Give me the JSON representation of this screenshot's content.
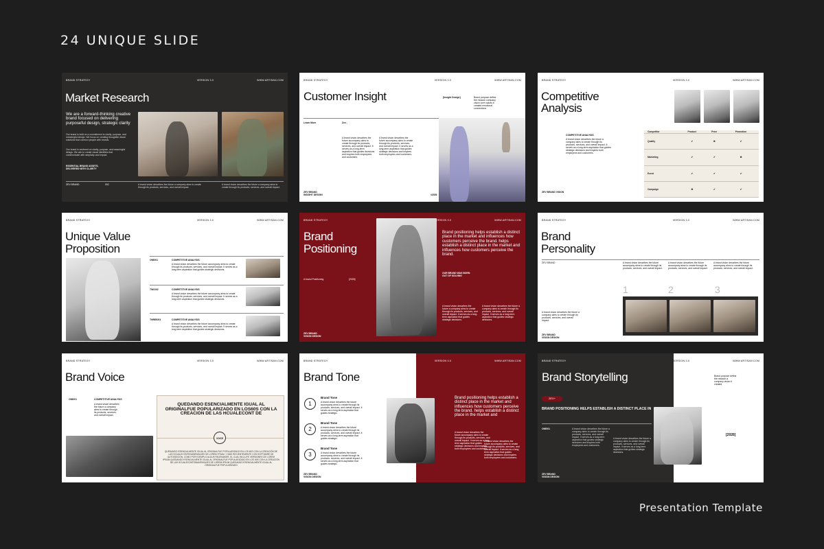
{
  "heading": "24 UNIQUE SLIDE",
  "footer_label": "Presentation Template",
  "common": {
    "brand_strategy": "BRAND STRATEGY",
    "version": "VERSION 3.0",
    "site": "WWW.ARTISAN.COM"
  },
  "slides": {
    "market": {
      "title": "Market Research",
      "lead": "We are a forward-thinking creative brand focused on delivering purposeful design, strategic clarity",
      "body1": "Our brand is built on a commitment to clarity, purpose, and meaningful design. We focus on creating thoughtful visual solutions that connect people with brands.",
      "body2": "Our brand is centered on clarity, purpose, and meaningful design. We aim to create visual identities that communicate with simplicity and impact.",
      "note": "ESSENTIAL BRAND ASSETS, DELIVERED WITH CLARITY",
      "foot_brand": "ZEV BRAND",
      "foot_num": "002",
      "foot_text": "A brand vision describes the future a company aims to create through its products, services, and overall impact."
    },
    "insight": {
      "title": "Customer Insight",
      "label": "[Insight Design]",
      "bullets": "Brand purpose define the mission company vision core values it created emotional connections",
      "learn": "Learn More",
      "zev": "Zev -",
      "col1": "A brand vision describes the future accompany aims to create through its products, services, and overall impact. It serves as a long-term aspiration that guides decisions and inspires both employees and customers.",
      "col2": "A brand vision describes the future accompany aims to create through its products, services, and overall impact. It serves as a long-term aspiration that guides strategic decisions and inspires both employees and customers.",
      "foot_brand": "ZEV BRAND INSIGHT DESIGN",
      "foot_num": "#2026"
    },
    "competitive": {
      "title": "Competitive Analysis",
      "sub": "COMPETITIVE ANALYSIS",
      "body": "A brand vision describes the future a company aims to create through its products, services, and overall impact. It serves as a long-term aspiration that guides strategic decisions and inspires both employees and customers.",
      "foot": "ZEV BRAND VISION",
      "table_headers": [
        "Competitor",
        "Product",
        "Price",
        "Promotion"
      ],
      "table_rows": [
        [
          "Quality",
          "✔",
          "✖",
          "✔"
        ],
        [
          "Marketing",
          "✔",
          "✔",
          "✖"
        ],
        [
          "Event",
          "✔",
          "✔",
          "✔"
        ],
        [
          "Campaign",
          "✖",
          "✔",
          "✔"
        ]
      ]
    },
    "uvp": {
      "title": "Unique Value Proposition",
      "items": [
        {
          "num": "ONE/01",
          "head": "COMPETITIVE ANALYSIS",
          "text": "A brand vision describes the future accompany aims to create through its products, services, and overall impact. It serves as a long-term aspiration that guides strategic decisions."
        },
        {
          "num": "TWO/02",
          "head": "COMPETITIVE ANALYSIS",
          "text": "A brand vision describes the future accompany aims to create through its products, services, and overall impact. It serves as a long-term aspiration that guides strategic decisions."
        },
        {
          "num": "THREE/03",
          "head": "COMPETITIVE ANALYSIS",
          "text": "A brand vision describes the future accompany aims to create through its products, services, and overall impact. It serves as a long-term aspiration that guides strategic decisions."
        }
      ]
    },
    "positioning": {
      "title": "Brand Positioning",
      "lead": "Brand positioning helps establish a distinct place in the market and influences how customers perceive the brand. helps establish a distinct place in the market and influences how customers perceive the brand.",
      "sub_left": "A brand Positioning",
      "year": "[2026]",
      "tag": "OUR BRAND WAS BORN OUT OF SOLVING",
      "col1": "A brand vision describes the future a company aims to create through its products, services, and overall impact. It serves as a long-term aspiration that guides strategic decisions.",
      "col2": "A brand vision describes the future a company aims to create through its products, services, and overall impact. It serves as a long-term aspiration that guides strategic decisions.",
      "foot": "ZEV BRAND VISION DESIGN"
    },
    "personality": {
      "title": "Brand Personality",
      "foot_brand": "ZEV BRAND",
      "cols": [
        "A brand vision describes the future accompany aims to create through its products, services, and overall impact.",
        "A brand vision describes the future accompany aims to create through its products, services, and overall impact.",
        "A brand vision describes the future accompany aims to create through its products, services, and overall impact."
      ],
      "nums": [
        "1",
        "2",
        "3"
      ],
      "left_text": "A brand vision describes the future a company aims to create through its products, services, and overall impact.",
      "foot": "ZEV BRAND VISION DESIGN"
    },
    "voice": {
      "title": "Brand Voice",
      "num": "ONE/01",
      "head": "COMPETITIVE ANALYSIS",
      "text": "A brand vision describes the future a company aims to create through its products, services, and overall impact.",
      "quote": "QUEDANDO ESENCIALMENTE IGUAL AL ORIGINALFUE POPULARIZADO EN LOS60S CON LA CREACIÓN DE LAS HCUALECONT DE",
      "badge": "VOICE",
      "bottom": "QUEDANDO ESENCIALMENTE IGUAL AL ORIGINALFUE POPULARIZADO EN LOS 60S CON LA CREACIÓN DE LAS HCUALECONTENIANPASAJES DE LOREM IPSUM, Y MÁS RECIENTEMENTE CON SOFTWARE DE AUTOEDICIÓN, COMO POR EJEMPLO ALDUS PAGEMAKER, EL CUAL INCLUYE VERSIONES DE LOREM IPSUM.QUEDANDO ESENCIALMENTE IGUAL AL ORIGINALFUE POPULARIZADO EN LOS 60S CON LA CREACIÓN DE LAS HCUALECONTENIANPASAJES DE LOREM IPSUM QUEDANDO ESENCIALMENTE IGUAL AL ORIGINALFUE POPULARIZADO"
    },
    "tone": {
      "title": "Brand Tone",
      "items": [
        {
          "num": "1",
          "head": "Brand Tone",
          "text": "A brand vision describes the future accompany aims to create through its products, services, and overall impact. It serves as a long-term aspiration that guides strategic."
        },
        {
          "num": "2",
          "head": "Brand Tone",
          "text": "A brand vision describes the future accompany aims to create through its products, services, and overall impact. It serves as a long-term aspiration that guides strategic."
        },
        {
          "num": "3",
          "head": "Brand Tone",
          "text": "A brand vision describes the future accompany aims to create through its products, services, and overall impact. It serves as a long-term aspiration that guides strategic."
        }
      ],
      "lead": "Brand positioning helps establish a distinct place in the market and influences how customers perceive the brand. helps establish a distinct place in the market and",
      "body": "A brand vision describes the future accompany aims to create through its products, services, and overall impact. It serves as a long-term aspiration that guides strategic decisions and inspires both employees and customers.",
      "foot": "ZEV BRAND VISION DESIGN"
    },
    "story": {
      "title": "Brand Storytelling",
      "bullets": "Brand purpose define the mission a company vision it created",
      "pill": "ZEX+",
      "lead": "BRAND POSITIONING HELPS ESTABLISH A DISTINCT PLACE IN",
      "num": "ONE/01",
      "body": "A brand vision describes the future a company aims to create through its products, services, and overall impact. It serves as a long-term aspiration that guides strategic decisions and inspires both employees and customers.",
      "text2": "A brand vision describes the future a company aims to create through its products, services, and overall impact. It serves as a long-term aspiration that guides strategic decisions.",
      "year": "[2026]",
      "foot": "ZEV BRAND VISION DESIGN"
    }
  }
}
